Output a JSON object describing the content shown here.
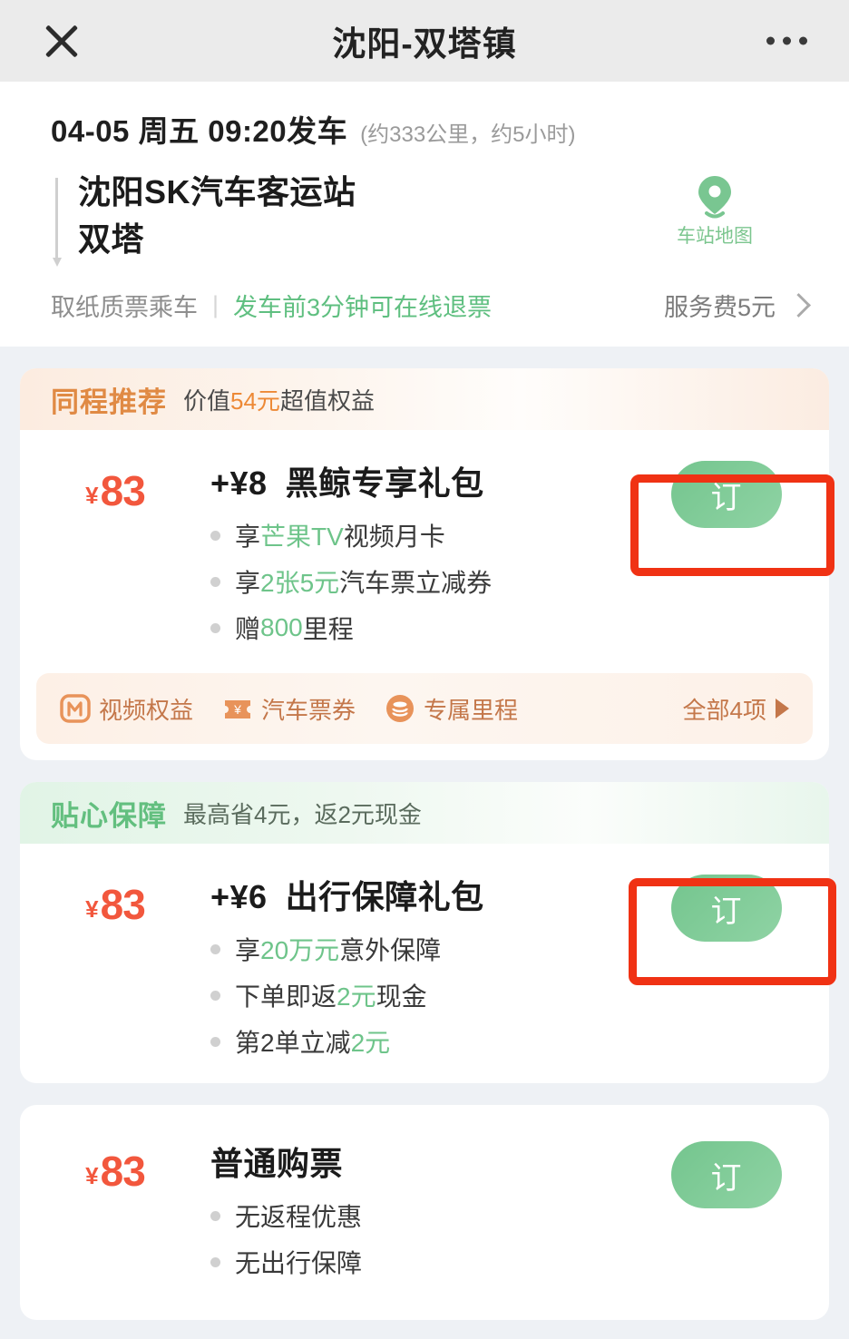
{
  "header": {
    "title": "沈阳-双塔镇",
    "close_icon": "close-icon",
    "more_icon": "more-options-icon"
  },
  "trip": {
    "depart_main": "04-05 周五 09:20发车",
    "depart_sub": "(约333公里，约5小时)",
    "origin_station": "沈阳SK汽车客运站",
    "destination_station": "双塔",
    "map_label": "车站地图",
    "map_icon": "location-pin-icon"
  },
  "notice": {
    "paper_ticket": "取纸质票乘车",
    "divider": "|",
    "refund": "发车前3分钟可在线退票",
    "service_fee": "服务费5元",
    "chevron_icon": "chevron-right-icon"
  },
  "colors": {
    "page_bg": "#eef1f5",
    "orange": "#ed8936",
    "green": "#6ec48a",
    "price_red": "#f2573d",
    "annotation_red": "#f03214"
  },
  "cards": [
    {
      "banner_tag": "同程推荐",
      "banner_desc_pre": "价值",
      "banner_desc_hl": "54元",
      "banner_desc_post": "超值权益",
      "price_symbol": "¥",
      "price_amount": "83",
      "addon": "+¥8",
      "title": "黑鲸专享礼包",
      "bullets": [
        {
          "pre": "享",
          "hl": "芒果TV",
          "post": "视频月卡"
        },
        {
          "pre": "享",
          "hl": "2张5元",
          "post": "汽车票立减券"
        },
        {
          "pre": "赠",
          "hl": "800",
          "post": "里程"
        }
      ],
      "order_label": "订",
      "benefits": [
        {
          "label": "视频权益",
          "icon": "mango-tv-icon"
        },
        {
          "label": "汽车票券",
          "icon": "ticket-coupon-icon"
        },
        {
          "label": "专属里程",
          "icon": "mileage-coins-icon"
        }
      ],
      "benefits_all": "全部4项"
    },
    {
      "banner_tag": "贴心保障",
      "banner_desc_pre": "最高省4元，返2元现金",
      "banner_desc_hl": "",
      "banner_desc_post": "",
      "price_symbol": "¥",
      "price_amount": "83",
      "addon": "+¥6",
      "title": "出行保障礼包",
      "bullets": [
        {
          "pre": "享",
          "hl": "20万元",
          "post": "意外保障"
        },
        {
          "pre": "下单即返",
          "hl": "2元",
          "post": "现金"
        },
        {
          "pre": "第2单立减",
          "hl": "2元",
          "post": ""
        }
      ],
      "order_label": "订"
    },
    {
      "price_symbol": "¥",
      "price_amount": "83",
      "addon": "",
      "title": "普通购票",
      "bullets": [
        {
          "pre": "无返程优惠",
          "hl": "",
          "post": ""
        },
        {
          "pre": "无出行保障",
          "hl": "",
          "post": ""
        }
      ],
      "order_label": "订"
    }
  ]
}
